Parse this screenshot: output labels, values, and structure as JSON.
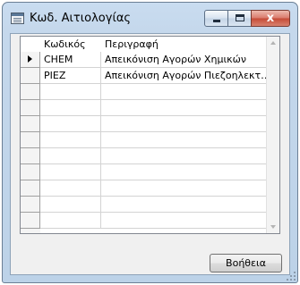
{
  "window": {
    "title": "Κωδ. Αιτιολογίας",
    "close_glyph": "x"
  },
  "grid": {
    "columns": [
      "Κωδικός",
      "Περιγραφή"
    ],
    "rows": [
      {
        "code": "CHEM",
        "description": "Απεικόνιση Αγορών Χημικών",
        "selected": true
      },
      {
        "code": "PIEZ",
        "description": "Απεικόνιση Αγορών Πιεζοηλεκτ…",
        "selected": false
      }
    ],
    "empty_rows": 9
  },
  "buttons": {
    "help_label": "Βοήθεια"
  },
  "colors": {
    "title_bar": "#c9dcf0",
    "close_button": "#c54a36",
    "client_bg": "#f0f0f0",
    "grid_bg": "#ffffff"
  }
}
